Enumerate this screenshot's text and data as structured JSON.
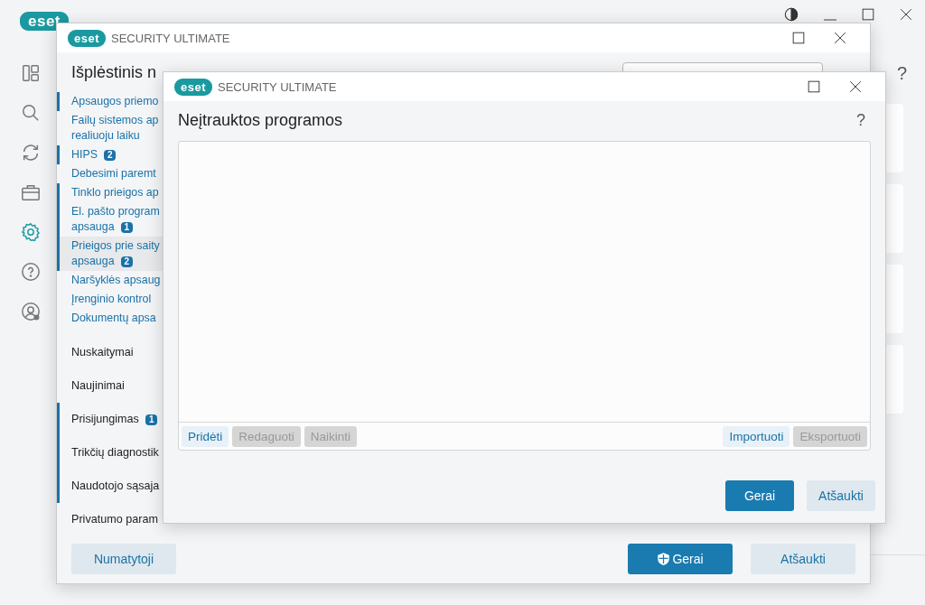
{
  "app": {
    "brand": "eset",
    "nav": [
      {
        "kind": "dashboard",
        "selected": false
      },
      {
        "kind": "search",
        "selected": false
      },
      {
        "kind": "update",
        "selected": false
      },
      {
        "kind": "tools",
        "selected": false
      },
      {
        "kind": "gear",
        "selected": true
      },
      {
        "kind": "help",
        "selected": false
      },
      {
        "kind": "account",
        "selected": false
      }
    ],
    "help": "?"
  },
  "advanced_window": {
    "brand": "eset",
    "product": "SECURITY ULTIMATE",
    "title": "Išplėstinis n",
    "nav": [
      {
        "kind": "sub",
        "lines": [
          "Apsaugos priemo"
        ],
        "modified": true,
        "selected": false
      },
      {
        "kind": "sub",
        "lines": [
          "Failų sistemos ap",
          "realiuoju laiku"
        ],
        "modified": false,
        "selected": false
      },
      {
        "kind": "sub",
        "lines": [
          "HIPS"
        ],
        "badge": "2",
        "modified": true,
        "selected": false
      },
      {
        "kind": "sub",
        "lines": [
          "Debesimi paremt"
        ],
        "modified": false,
        "selected": false
      },
      {
        "kind": "sub",
        "lines": [
          "Tinklo prieigos ap"
        ],
        "modified": true,
        "selected": false
      },
      {
        "kind": "sub",
        "lines": [
          "El. pašto program",
          "apsauga"
        ],
        "badge": "1",
        "modified": true,
        "selected": false
      },
      {
        "kind": "sub",
        "lines": [
          "Prieigos prie saity",
          "apsauga"
        ],
        "badge": "2",
        "modified": true,
        "selected": true
      },
      {
        "kind": "sub",
        "lines": [
          "Naršyklės apsaug"
        ],
        "modified": false,
        "selected": false
      },
      {
        "kind": "sub",
        "lines": [
          "Įrenginio kontrol"
        ],
        "modified": false,
        "selected": false
      },
      {
        "kind": "sub",
        "lines": [
          "Dokumentų apsa"
        ],
        "modified": false,
        "selected": false
      },
      {
        "kind": "section",
        "lines": [
          "Nuskaitymai"
        ],
        "modified": false,
        "selected": false
      },
      {
        "kind": "section",
        "lines": [
          "Naujinimai"
        ],
        "modified": false,
        "selected": false
      },
      {
        "kind": "section",
        "lines": [
          "Prisijungimas"
        ],
        "badge": "1",
        "modified": true,
        "selected": false
      },
      {
        "kind": "section",
        "lines": [
          "Trikčių diagnostik"
        ],
        "modified": true,
        "selected": false
      },
      {
        "kind": "section",
        "lines": [
          "Naudotojo sąsaja"
        ],
        "modified": true,
        "selected": false
      },
      {
        "kind": "section",
        "lines": [
          "Privatumo param"
        ],
        "modified": false,
        "selected": false
      }
    ],
    "default_button": "Numatytoji",
    "buttons": [
      {
        "kind": "primary",
        "label": "Gerai",
        "shield": true
      },
      {
        "kind": "secondary",
        "label": "Atšaukti",
        "shield": false
      }
    ]
  },
  "dialog": {
    "brand": "eset",
    "product": "SECURITY ULTIMATE",
    "title": "Neįtrauktos programos",
    "help": "?",
    "left_buttons": [
      {
        "label": "Pridėti",
        "disabled": false
      },
      {
        "label": "Redaguoti",
        "disabled": true
      },
      {
        "label": "Naikinti",
        "disabled": true
      }
    ],
    "right_buttons": [
      {
        "label": "Importuoti",
        "disabled": false
      },
      {
        "label": "Eksportuoti",
        "disabled": true
      }
    ],
    "buttons": [
      {
        "kind": "primary",
        "label": "Gerai",
        "shield": false
      },
      {
        "kind": "secondary",
        "label": "Atšaukti",
        "shield": false
      }
    ]
  }
}
